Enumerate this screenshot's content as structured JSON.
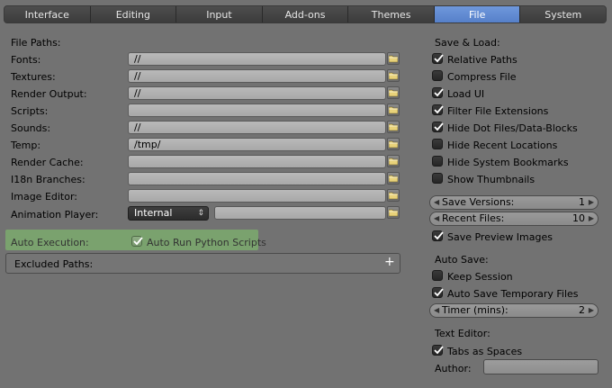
{
  "tabs": [
    "Interface",
    "Editing",
    "Input",
    "Add-ons",
    "Themes",
    "File",
    "System"
  ],
  "active_tab": "File",
  "file_paths": {
    "heading": "File Paths:",
    "rows": [
      {
        "label": "Fonts:",
        "value": "//"
      },
      {
        "label": "Textures:",
        "value": "//"
      },
      {
        "label": "Render Output:",
        "value": "//"
      },
      {
        "label": "Scripts:",
        "value": ""
      },
      {
        "label": "Sounds:",
        "value": "//"
      },
      {
        "label": "Temp:",
        "value": "/tmp/"
      },
      {
        "label": "Render Cache:",
        "value": ""
      },
      {
        "label": "I18n Branches:",
        "value": ""
      },
      {
        "label": "Image Editor:",
        "value": ""
      }
    ],
    "animation_player": {
      "label": "Animation Player:",
      "selected": "Internal",
      "path": ""
    }
  },
  "auto_execution": {
    "label": "Auto Execution:",
    "checkbox_label": "Auto Run Python Scripts",
    "checked": true
  },
  "excluded_paths": {
    "label": "Excluded Paths:"
  },
  "save_load": {
    "heading": "Save & Load:",
    "options": [
      {
        "label": "Relative Paths",
        "checked": true
      },
      {
        "label": "Compress File",
        "checked": false
      },
      {
        "label": "Load UI",
        "checked": true
      },
      {
        "label": "Filter File Extensions",
        "checked": true
      },
      {
        "label": "Hide Dot Files/Data-Blocks",
        "checked": true
      },
      {
        "label": "Hide Recent Locations",
        "checked": false
      },
      {
        "label": "Hide System Bookmarks",
        "checked": false
      },
      {
        "label": "Show Thumbnails",
        "checked": false
      }
    ],
    "save_versions": {
      "label": "Save Versions:",
      "value": "1"
    },
    "recent_files": {
      "label": "Recent Files:",
      "value": "10"
    },
    "save_preview": {
      "label": "Save Preview Images",
      "checked": true
    }
  },
  "auto_save": {
    "heading": "Auto Save:",
    "keep_session": {
      "label": "Keep Session",
      "checked": false
    },
    "auto_save_temp": {
      "label": "Auto Save Temporary Files",
      "checked": true
    },
    "timer": {
      "label": "Timer (mins):",
      "value": "2"
    }
  },
  "text_editor": {
    "heading": "Text Editor:",
    "tabs_as_spaces": {
      "label": "Tabs as Spaces",
      "checked": true
    },
    "author_label": "Author:",
    "author_value": ""
  },
  "colors": {
    "accent": "#5680c9",
    "auto_exec_bg": "#7aa26e",
    "panel_bg": "#727272"
  }
}
